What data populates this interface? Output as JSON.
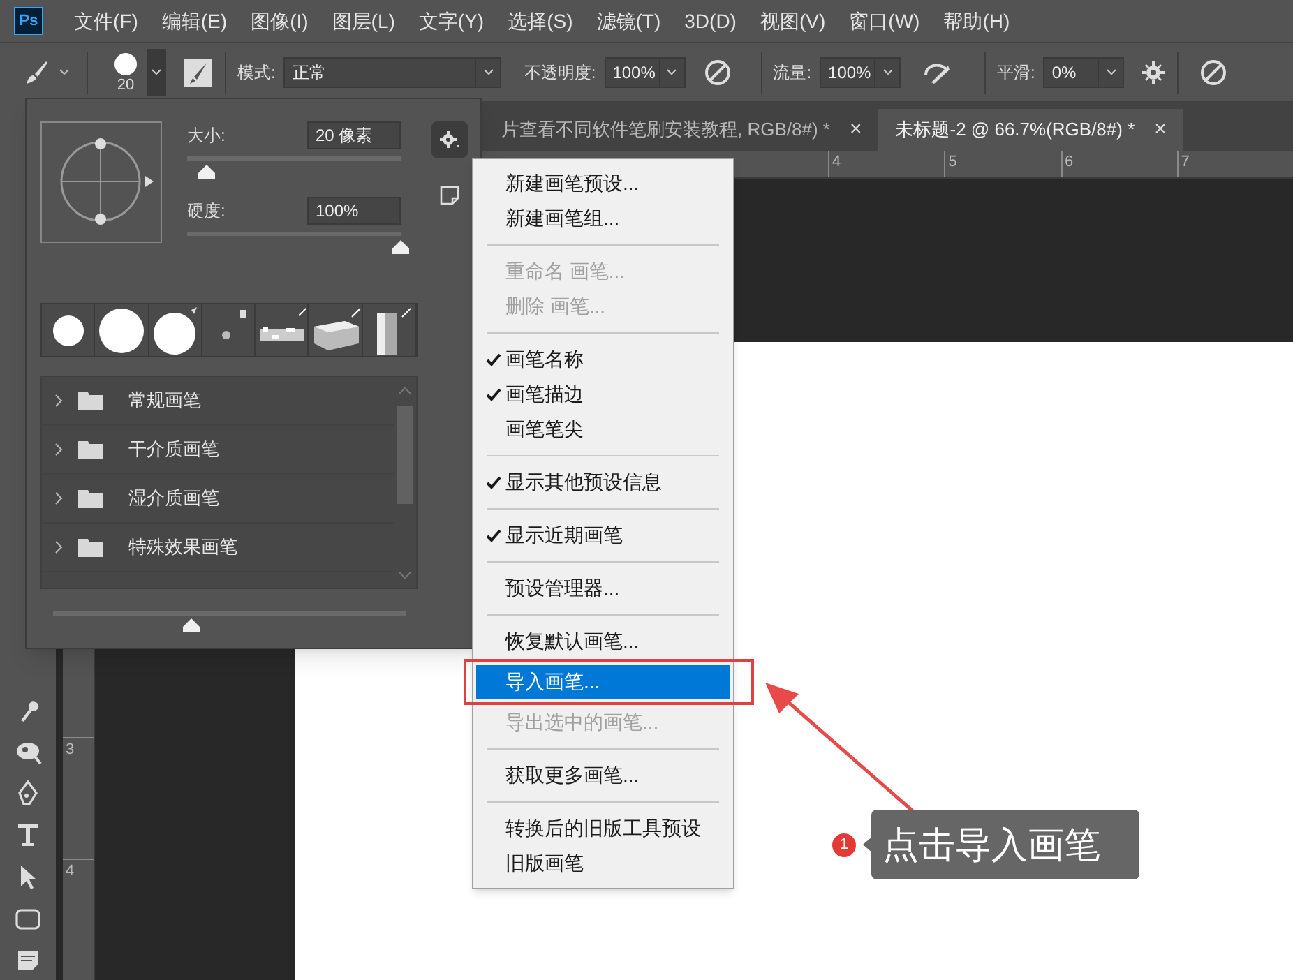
{
  "app_logo": "Ps",
  "menu_bar": [
    "文件(F)",
    "编辑(E)",
    "图像(I)",
    "图层(L)",
    "文字(Y)",
    "选择(S)",
    "滤镜(T)",
    "3D(D)",
    "视图(V)",
    "窗口(W)",
    "帮助(H)"
  ],
  "options_bar": {
    "brush_size": "20",
    "mode_label": "模式:",
    "mode_value": "正常",
    "opacity_label": "不透明度:",
    "opacity_value": "100%",
    "flow_label": "流量:",
    "flow_value": "100%",
    "smoothing_label": "平滑:",
    "smoothing_value": "0%"
  },
  "document_tabs": [
    {
      "label": "片查看不同软件笔刷安装教程, RGB/8#) *",
      "close": "×",
      "selected": false
    },
    {
      "label": "未标题-2 @ 66.7%(RGB/8#) *",
      "close": "×",
      "selected": true
    }
  ],
  "rulers": {
    "horizontal": [
      "4",
      "5",
      "6",
      "7"
    ],
    "vertical": [
      "3",
      "4"
    ]
  },
  "brush_panel": {
    "size_label": "大小:",
    "size_value": "20 像素",
    "size_slider": {
      "level": 0.09
    },
    "hardness_label": "硬度:",
    "hardness_value": "100%",
    "hardness_slider": {
      "level": 1
    },
    "brush_groups": [
      {
        "label": "常规画笔",
        "expanded": false
      },
      {
        "label": "干介质画笔",
        "expanded": false
      },
      {
        "label": "湿介质画笔",
        "expanded": false
      },
      {
        "label": "特殊效果画笔",
        "expanded": false
      }
    ],
    "preview_slider": {
      "level": 0.39
    }
  },
  "context_menu": [
    {
      "kind": "item",
      "label": "新建画笔预设...",
      "checked": false,
      "disabled": false,
      "selected": false
    },
    {
      "kind": "item",
      "label": "新建画笔组...",
      "checked": false,
      "disabled": false,
      "selected": false
    },
    {
      "kind": "separator"
    },
    {
      "kind": "item",
      "label": "重命名 画笔...",
      "checked": false,
      "disabled": true,
      "selected": false
    },
    {
      "kind": "item",
      "label": "删除 画笔...",
      "checked": false,
      "disabled": true,
      "selected": false
    },
    {
      "kind": "separator"
    },
    {
      "kind": "item",
      "label": "画笔名称",
      "checked": true,
      "disabled": false,
      "selected": false
    },
    {
      "kind": "item",
      "label": "画笔描边",
      "checked": true,
      "disabled": false,
      "selected": false
    },
    {
      "kind": "item",
      "label": "画笔笔尖",
      "checked": false,
      "disabled": false,
      "selected": false
    },
    {
      "kind": "separator"
    },
    {
      "kind": "item",
      "label": "显示其他预设信息",
      "checked": true,
      "disabled": false,
      "selected": false
    },
    {
      "kind": "separator"
    },
    {
      "kind": "item",
      "label": "显示近期画笔",
      "checked": true,
      "disabled": false,
      "selected": false
    },
    {
      "kind": "separator"
    },
    {
      "kind": "item",
      "label": "预设管理器...",
      "checked": false,
      "disabled": false,
      "selected": false
    },
    {
      "kind": "separator"
    },
    {
      "kind": "item",
      "label": "恢复默认画笔...",
      "checked": false,
      "disabled": false,
      "selected": false
    },
    {
      "kind": "item",
      "label": "导入画笔...",
      "checked": false,
      "disabled": false,
      "selected": true
    },
    {
      "kind": "item",
      "label": "导出选中的画笔...",
      "checked": false,
      "disabled": true,
      "selected": false
    },
    {
      "kind": "separator"
    },
    {
      "kind": "item",
      "label": "获取更多画笔...",
      "checked": false,
      "disabled": false,
      "selected": false
    },
    {
      "kind": "separator"
    },
    {
      "kind": "item",
      "label": "转换后的旧版工具预设",
      "checked": false,
      "disabled": false,
      "selected": false
    },
    {
      "kind": "item",
      "label": "旧版画笔",
      "checked": false,
      "disabled": false,
      "selected": false
    }
  ],
  "annotation": {
    "step": "1",
    "text": "点击导入画笔"
  }
}
